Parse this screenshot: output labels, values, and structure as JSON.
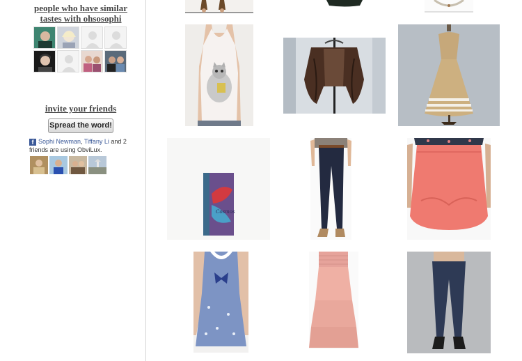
{
  "sidebar": {
    "similar_heading_line1": "people who have similar",
    "similar_heading_line2": "tastes with ohsosophi",
    "invite_heading": "invite your friends",
    "spread_button": "Spread the word!",
    "facebook": {
      "friend1": "Sophi Newman",
      "separator": ", ",
      "friend2": "Tiffany Li",
      "suffix": " and 2 friends are using ObviLux."
    }
  },
  "products": [
    {
      "name": "sandals"
    },
    {
      "name": "dark handbag"
    },
    {
      "name": "bracelet"
    },
    {
      "name": "cat print tank top"
    },
    {
      "name": "fur stole"
    },
    {
      "name": "vintage striped dress"
    },
    {
      "name": "book"
    },
    {
      "name": "dark skinny jeans"
    },
    {
      "name": "coral skirt"
    },
    {
      "name": "blue floral dress with bow"
    },
    {
      "name": "peach tiered maxi skirt"
    },
    {
      "name": "dark wash jeans"
    }
  ]
}
